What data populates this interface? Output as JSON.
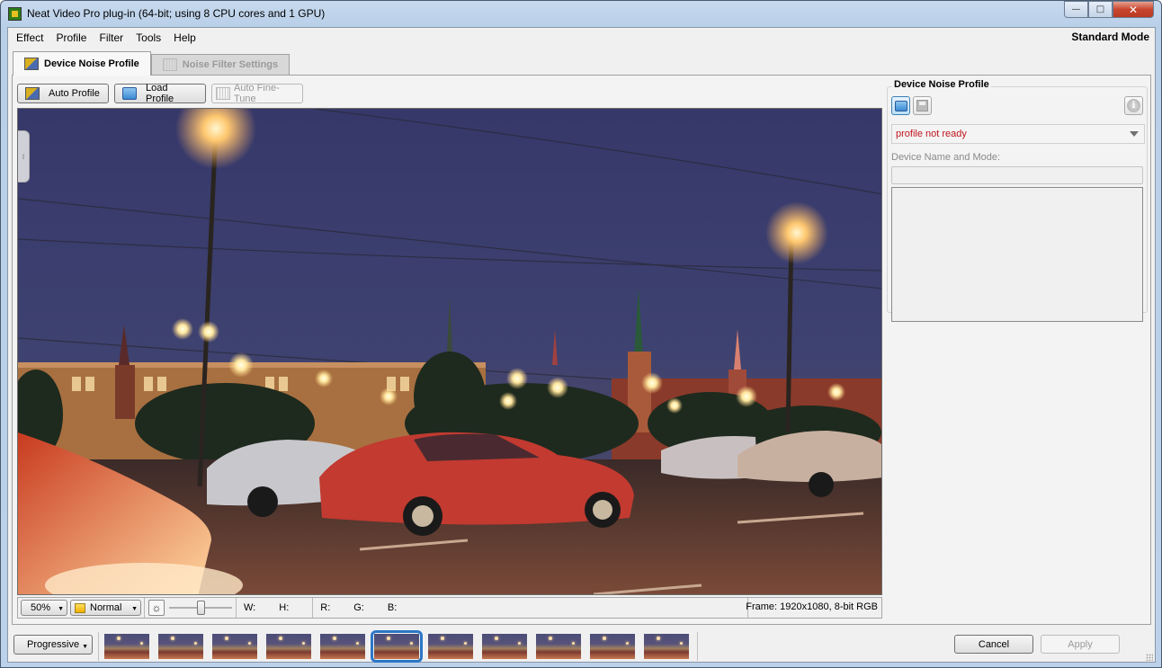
{
  "window": {
    "title": "Neat Video Pro plug-in (64-bit; using 8 CPU cores and 1 GPU)",
    "controls": {
      "minimize": "—",
      "maximize": "□",
      "close": "✕"
    }
  },
  "menubar": {
    "items": [
      "Effect",
      "Profile",
      "Filter",
      "Tools",
      "Help"
    ],
    "mode": "Standard Mode"
  },
  "tabs": [
    {
      "label": "Device Noise Profile",
      "icon": "film-wand-icon",
      "active": true
    },
    {
      "label": "Noise Filter Settings",
      "icon": "sliders-icon",
      "active": false
    }
  ],
  "toolbar": {
    "auto_profile": "Auto Profile",
    "load_profile": "Load Profile",
    "auto_fine_tune": "Auto Fine-Tune"
  },
  "preview": {
    "scene": "night city street with Kremlin towers, street lamps and cars",
    "zoom": "50%",
    "view_mode": "Normal",
    "w_label": "W:",
    "h_label": "H:",
    "r_label": "R:",
    "g_label": "G:",
    "b_label": "B:",
    "frame_info": "Frame: 1920x1080, 8-bit RGB",
    "brightness_slider": 0.5
  },
  "right_panel": {
    "group_title": "Device Noise Profile",
    "profile_status": "profile not ready",
    "status_color": "#c0141c",
    "device_label": "Device Name and Mode:",
    "device_value": "",
    "notes": ""
  },
  "bottom": {
    "scan_mode": "Progressive",
    "thumbnail_count": 11,
    "selected_thumbnail": 6,
    "cancel": "Cancel",
    "apply": "Apply"
  },
  "colors": {
    "accent": "#2c77c6",
    "sky": "#3a3f68"
  }
}
